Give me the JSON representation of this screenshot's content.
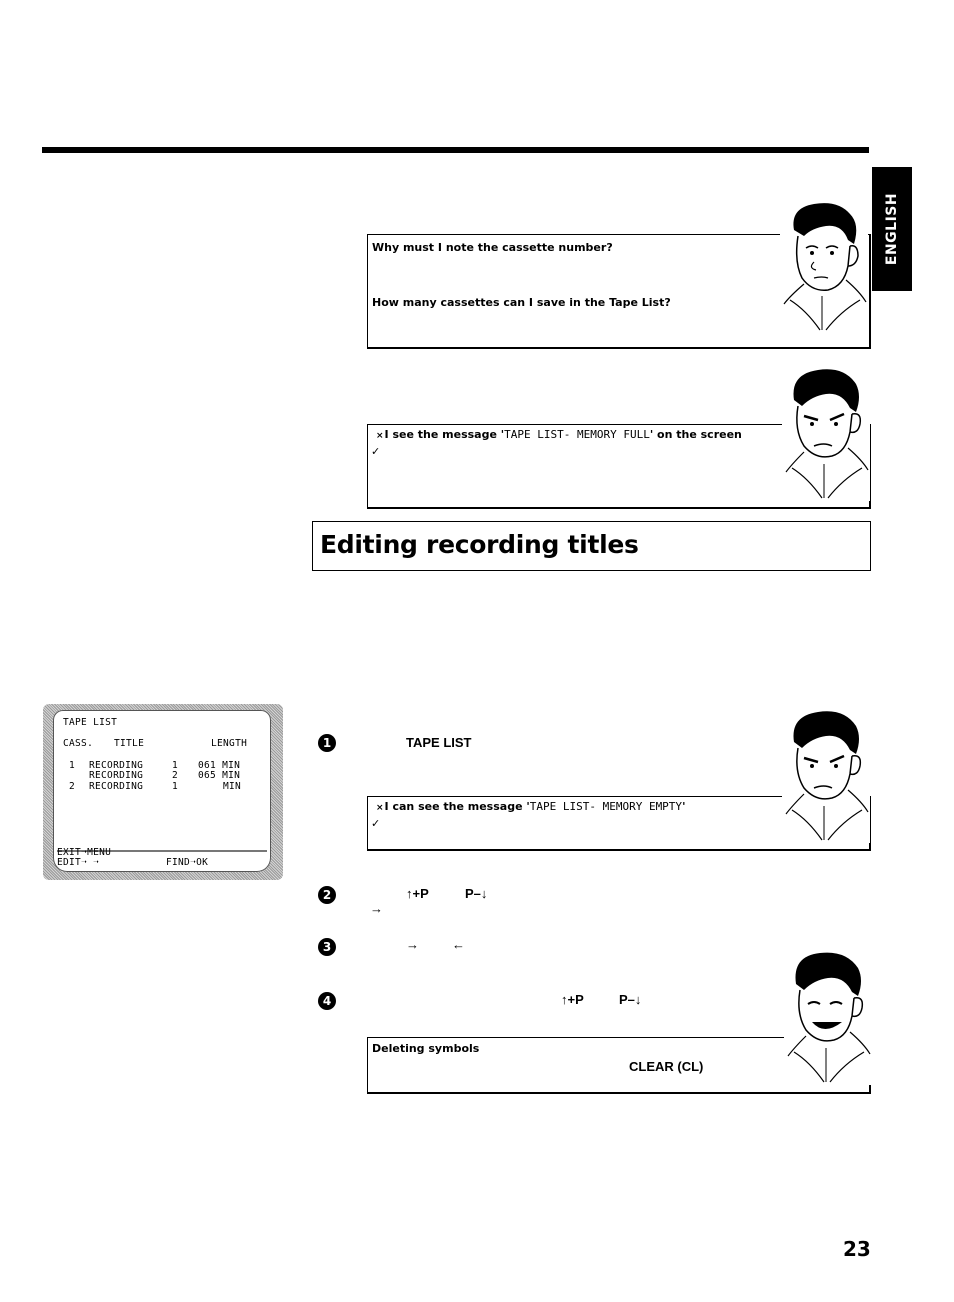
{
  "page": {
    "language_tab": "ENGLISH",
    "page_number": "23"
  },
  "tip_box_1": {
    "question_1": "Why must I note the cassette number?",
    "question_2": "How many cassettes can I save in the Tape List?"
  },
  "tip_box_2": {
    "problem_prefix": "I see the message '",
    "problem_code": "TAPE LIST- MEMORY FULL",
    "problem_suffix": "' on the screen",
    "solution_mark": "✓"
  },
  "section": {
    "title": "Editing recording titles"
  },
  "tv_screen": {
    "heading": "TAPE LIST",
    "columns": [
      "CASS.",
      "TITLE",
      "LENGTH"
    ],
    "rows": [
      {
        "cass": "1",
        "title": "RECORDING",
        "num": "1",
        "length": "061 MIN"
      },
      {
        "cass": "",
        "title": "RECORDING",
        "num": "2",
        "length": "065 MIN"
      },
      {
        "cass": "2",
        "title": "RECORDING",
        "num": "1",
        "length": "MIN"
      }
    ],
    "footer_line_1": "EXIT➝MENU",
    "footer_line_2_left": "EDIT➝ ➝",
    "footer_line_2_right": "FIND➝OK"
  },
  "steps": [
    {
      "number": "1",
      "key_label": "TAPE LIST"
    },
    {
      "number": "2",
      "key_up": "↑+P",
      "key_down": "P–↓",
      "arrow": "→"
    },
    {
      "number": "3",
      "arrow_right": "→",
      "arrow_left": "←"
    },
    {
      "number": "4",
      "key_up": "↑+P",
      "key_down": "P–↓"
    }
  ],
  "tip_box_3": {
    "problem_prefix": "I can see the message '",
    "problem_code": "TAPE LIST- MEMORY EMPTY",
    "problem_suffix": "'",
    "solution_mark": "✓"
  },
  "tip_box_4": {
    "heading": "Deleting symbols",
    "key_label": "CLEAR (CL)"
  },
  "icons": {
    "x_mark": "×"
  }
}
